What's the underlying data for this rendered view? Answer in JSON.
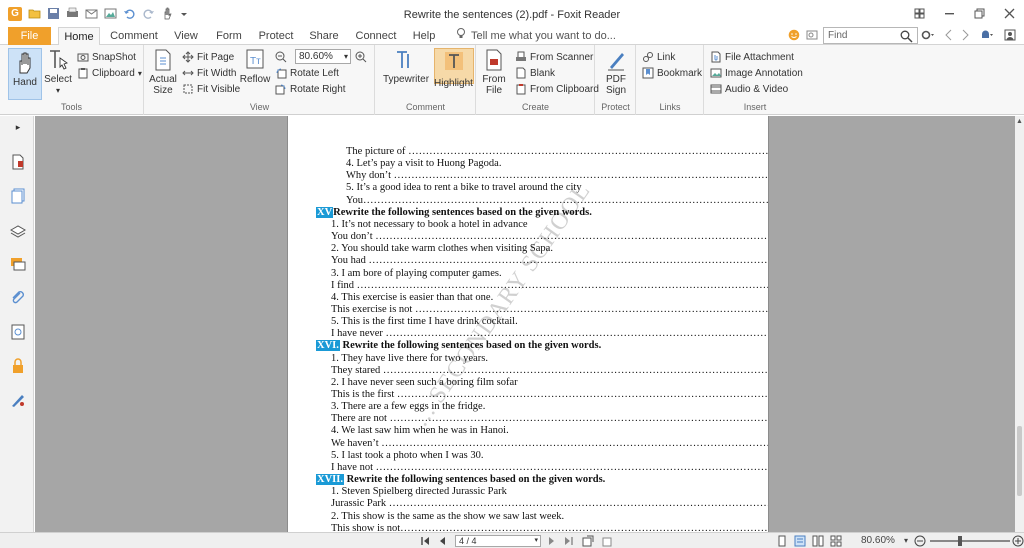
{
  "window": {
    "title": "Rewrite the sentences (2).pdf - Foxit Reader",
    "app_logo": "G"
  },
  "tabs": [
    "File",
    "Home",
    "Comment",
    "View",
    "Form",
    "Protect",
    "Share",
    "Connect",
    "Help"
  ],
  "tell_me": "Tell me what you want to do...",
  "find_placeholder": "Find",
  "ribbon": {
    "tools": {
      "label": "Tools",
      "hand": "Hand",
      "select": "Select",
      "snapshot": "SnapShot",
      "clipboard": "Clipboard"
    },
    "view": {
      "label": "View",
      "actual_size": "Actual\nSize",
      "fit_page": "Fit Page",
      "fit_width": "Fit Width",
      "fit_visible": "Fit Visible",
      "reflow": "Reflow",
      "zoom": "80.60%",
      "rotate_left": "Rotate Left",
      "rotate_right": "Rotate Right"
    },
    "comment": {
      "label": "Comment",
      "typewriter": "Typewriter",
      "highlight": "Highlight"
    },
    "create": {
      "label": "Create",
      "from_file": "From\nFile",
      "from_scanner": "From Scanner",
      "blank": "Blank",
      "from_clipboard": "From Clipboard"
    },
    "protect": {
      "label": "Protect",
      "pdf_sign": "PDF\nSign"
    },
    "links": {
      "label": "Links",
      "link": "Link",
      "bookmark": "Bookmark"
    },
    "insert": {
      "label": "Insert",
      "file_attachment": "File Attachment",
      "image_annotation": "Image Annotation",
      "audio_video": "Audio & Video"
    }
  },
  "document": {
    "watermark": "... SECONDARY SCHOOL",
    "lines": [
      {
        "text": "The picture of ……………………………………………………………………………………………………………………………….",
        "indent": 58
      },
      {
        "text": "4. Let’s pay a visit to Huong Pagoda.",
        "indent": 58
      },
      {
        "text": "Why don’t ………………………………………………………………………………………………………………………………………",
        "indent": 58
      },
      {
        "text": "5. It’s a good idea to rent a bike to travel around the city",
        "indent": 58
      },
      {
        "text": "You…………………………………………………………………………………………………………………………………………………………",
        "indent": 58
      },
      {
        "tag": "XV",
        "text": "Rewrite the following sentences based on the given words.",
        "indent": 28,
        "head": true
      },
      {
        "text": "1. It’s not necessary to book a hotel in advance",
        "indent": 43
      },
      {
        "text": "You don’t …………………………………………………………………………………………………………………………………………………",
        "indent": 43
      },
      {
        "text": "2. You should take warm clothes when visiting Sapa.",
        "indent": 43
      },
      {
        "text": "You had ……………………………………………………………………………………………………………………………………………………",
        "indent": 43
      },
      {
        "text": "3. I am bore of playing computer games.",
        "indent": 43
      },
      {
        "text": "I find ………………………………………………………………………………………………………………………………………………………",
        "indent": 43
      },
      {
        "text": "4. This exercise is easier than that one.",
        "indent": 43
      },
      {
        "text": "This exercise is not …………………………………………………………………………………………………………………………………",
        "indent": 43
      },
      {
        "text": "5. This is the first time I have drink cocktail.",
        "indent": 43
      },
      {
        "text": "I have never ………………………………………………………………………………………………………………………………………………",
        "indent": 43
      },
      {
        "tag": "XVI.",
        "text": " Rewrite the following sentences based on the given words.",
        "indent": 28,
        "head": true
      },
      {
        "text": "1. They have live there for two years.",
        "indent": 43
      },
      {
        "text": "They stared …………………………………………………………………………………………………………………………………………………",
        "indent": 43
      },
      {
        "text": "2. I have never seen such a boring film sofar",
        "indent": 43
      },
      {
        "text": "This is the first ……………………………………………………………………………………………………………………………………",
        "indent": 43
      },
      {
        "text": "3. There are a few eggs in the fridge.",
        "indent": 43
      },
      {
        "text": "There are not ……………………………………………………………………………………………………………………………………………",
        "indent": 43
      },
      {
        "text": "4. We last saw him when he was in Hanoi.",
        "indent": 43
      },
      {
        "text": "We haven’t ……………………………………………………………………………………………………………………………………………………..",
        "indent": 43
      },
      {
        "text": "5. I last took a photo when I was 30.",
        "indent": 43
      },
      {
        "text": "I have not ……………………………………………………………………………………………………………………………………………………",
        "indent": 43
      },
      {
        "tag": "XVII.",
        "text": " Rewrite the following sentences based on the given words.",
        "indent": 28,
        "head": true
      },
      {
        "text": "1. Steven Spielberg directed Jurassic Park",
        "indent": 43
      },
      {
        "text": "Jurassic Park …………………………………………………………………………………………………………………………………………………",
        "indent": 43
      },
      {
        "text": "2. This show is the same as the show we saw last week.",
        "indent": 43
      },
      {
        "text": "This show is not…………………………………………………………………………………………………………………………………………………………",
        "indent": 43
      }
    ]
  },
  "statusbar": {
    "page": "4 / 4",
    "zoom": "80.60%"
  },
  "colors": {
    "accent": "#f0a02b",
    "highlight": "#1a9ad6",
    "doc_bg": "#a6a6a6"
  }
}
